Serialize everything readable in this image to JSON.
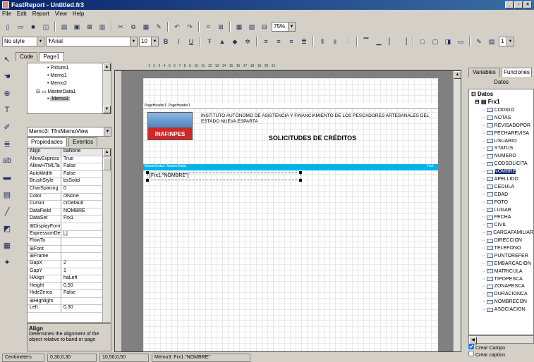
{
  "window": {
    "title": "FastReport - Untitled.fr3",
    "controls": [
      "_",
      "▫",
      "×"
    ]
  },
  "menu": [
    "File",
    "Edit",
    "Report",
    "View",
    "Help"
  ],
  "toolbar": {
    "zoom": "75%",
    "style": "No style",
    "font": "Arial",
    "size": "10",
    "page_num": "1"
  },
  "tabs": {
    "code": "Code",
    "page1": "Page1"
  },
  "tree": {
    "items": [
      "Picture1",
      "Memo1",
      "Memo2",
      "MasterData1",
      "Memo3"
    ]
  },
  "object_selector": "Memo3: TfrxMemoView",
  "inspector_tabs": {
    "props": "Propiedades",
    "events": "Eventos"
  },
  "properties": [
    {
      "k": "Align",
      "v": "baNone"
    },
    {
      "k": "AllowExpress",
      "v": "True"
    },
    {
      "k": "AllowHTMLTa",
      "v": "False"
    },
    {
      "k": "AutoWidth",
      "v": "False"
    },
    {
      "k": "BrushStyle",
      "v": "bsSolid"
    },
    {
      "k": "CharSpacing",
      "v": "0"
    },
    {
      "k": "Color",
      "v": "clNone"
    },
    {
      "k": "Cursor",
      "v": "crDefault"
    },
    {
      "k": "DataField",
      "v": "NOMBRE"
    },
    {
      "k": "DataSet",
      "v": "Frx1"
    },
    {
      "k": "⊞DisplayForma",
      "v": ""
    },
    {
      "k": "ExpressionDe",
      "v": "[,]"
    },
    {
      "k": "FlowTo",
      "v": ""
    },
    {
      "k": "⊞Font",
      "v": ""
    },
    {
      "k": "⊞Frame",
      "v": ""
    },
    {
      "k": "GapX",
      "v": "2"
    },
    {
      "k": "GapY",
      "v": "1"
    },
    {
      "k": "HAlign",
      "v": "haLeft"
    },
    {
      "k": "Height",
      "v": "0,50"
    },
    {
      "k": "HideZeros",
      "v": "False"
    },
    {
      "k": "⊞Highlight",
      "v": ""
    },
    {
      "k": "Left",
      "v": "0,30"
    }
  ],
  "help": {
    "title": "Align",
    "text": "Determines the alignment of the object relative to band or page"
  },
  "report": {
    "page_header_label": "PageHeader1: PageHeader1",
    "logo_text": "INAFINPES",
    "institution": "INSTITUTO AUTÓNOMO DE ASISTENCIA Y FINANCIAMIENTO DE LOS PESCADORES ARTESANALES DEL ESTADO NUEVA ESPARTA",
    "title": "SOLICITUDES DE CRÉDITOS",
    "master_label": "MasterData1: MasterData1",
    "master_right": "Frx1",
    "memo_text": "[Frx1.\"NOMBRE\"]"
  },
  "ruler": "· 1 · 2 · 3 · 4 · 5 · 6 · 7 · 8 · 9 · 10 · 11 · 12 · 13 · 14 · 15 · 16 · 17 · 18 · 19 · 20 · 21 ·",
  "right_panel": {
    "tab_vars": "Variables",
    "tab_funcs": "Funciones",
    "header": "Datos",
    "root": "Datos",
    "dataset": "Frx1",
    "fields": [
      "CODIGO",
      "NOTAS",
      "REVISADOPOR",
      "FECHAREVISA",
      "USUARIO",
      "STATUS",
      "NUMERO",
      "CODSOLICITA",
      "NOMBRE",
      "APELLIDO",
      "CEDULA",
      "EDAD",
      "FOTO",
      "LUGAR",
      "FECHA",
      "CIVIL",
      "CARGAFAMILIAR",
      "DIRECCION",
      "TELEFONO",
      "PUNTOREFER",
      "EMBARCACION",
      "MATRICULA",
      "TIPOPESCA",
      "ZONAPESCA",
      "DURACIONCA",
      "NOMBRECON",
      "ASOCIACION"
    ],
    "selected": "NOMBRE",
    "chk_create_field": "Crear Campo",
    "chk_create_caption": "Crear caption",
    "chk_create_field_checked": true,
    "chk_create_caption_checked": false
  },
  "status": {
    "units": "Centimeters",
    "pos1": "0,30;0,30",
    "pos2": "10,50;0,50",
    "obj": "Memo3: Frx1.\"NOMBRE\""
  }
}
